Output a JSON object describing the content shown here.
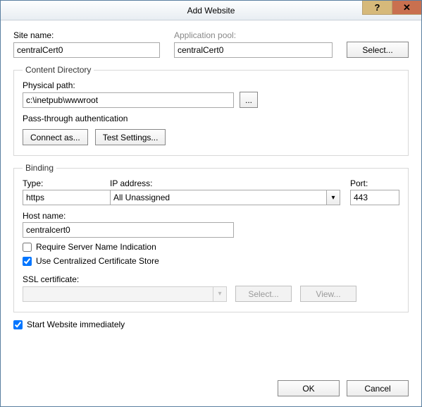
{
  "window": {
    "title": "Add Website"
  },
  "site_name": {
    "label": "Site name:",
    "value": "centralCert0"
  },
  "app_pool": {
    "label": "Application pool:",
    "value": "centralCert0",
    "select_btn": "Select..."
  },
  "content_dir": {
    "legend": "Content Directory",
    "path_label": "Physical path:",
    "path_value": "c:\\inetpub\\wwwroot",
    "browse_btn": "...",
    "auth_label": "Pass-through authentication",
    "connect_as_btn": "Connect as...",
    "test_settings_btn": "Test Settings..."
  },
  "binding": {
    "legend": "Binding",
    "type_label": "Type:",
    "type_value": "https",
    "ip_label": "IP address:",
    "ip_value": "All Unassigned",
    "port_label": "Port:",
    "port_value": "443",
    "host_label": "Host name:",
    "host_value": "centralcert0",
    "sni_label": "Require Server Name Indication",
    "sni_checked": false,
    "ccs_label": "Use Centralized Certificate Store",
    "ccs_checked": true,
    "ssl_label": "SSL certificate:",
    "ssl_value": "",
    "ssl_select_btn": "Select...",
    "ssl_view_btn": "View..."
  },
  "start_immediate": {
    "label": "Start Website immediately",
    "checked": true
  },
  "footer": {
    "ok": "OK",
    "cancel": "Cancel"
  }
}
